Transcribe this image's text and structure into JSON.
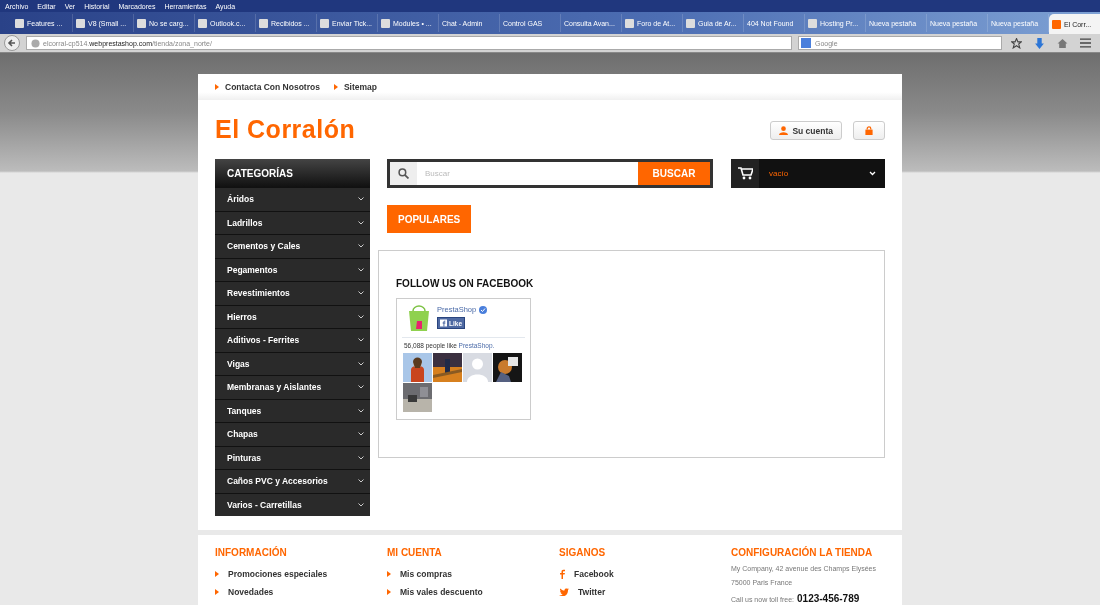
{
  "menu_bar": [
    "Archivo",
    "Editar",
    "Ver",
    "Historial",
    "Marcadores",
    "Herramientas",
    "Ayuda"
  ],
  "tabs": [
    {
      "label": "Features ...",
      "has_icon": true,
      "selected": false
    },
    {
      "label": "V8 (Small ...",
      "has_icon": true,
      "selected": false
    },
    {
      "label": "No se carg...",
      "has_icon": true,
      "selected": false
    },
    {
      "label": "Outlook.c...",
      "has_icon": true,
      "selected": false
    },
    {
      "label": "Recibidos ...",
      "has_icon": true,
      "selected": false
    },
    {
      "label": "Enviar Tick...",
      "has_icon": true,
      "selected": false
    },
    {
      "label": "Modules • ...",
      "has_icon": true,
      "selected": false
    },
    {
      "label": "Chat - Admin",
      "has_icon": false,
      "selected": false
    },
    {
      "label": "Control GAS",
      "has_icon": false,
      "selected": false
    },
    {
      "label": "Consulta Avan...",
      "has_icon": false,
      "selected": false
    },
    {
      "label": "Foro de At...",
      "has_icon": true,
      "selected": false
    },
    {
      "label": "Guia de Ar...",
      "has_icon": true,
      "selected": false
    },
    {
      "label": "404 Not Found",
      "has_icon": false,
      "selected": false
    },
    {
      "label": "Hosting Pr...",
      "has_icon": true,
      "selected": false
    },
    {
      "label": "Nueva pestaña",
      "has_icon": false,
      "selected": false
    },
    {
      "label": "Nueva pestaña",
      "has_icon": false,
      "selected": false
    },
    {
      "label": "Nueva pestaña",
      "has_icon": false,
      "selected": false
    },
    {
      "label": "El Corr...",
      "has_icon": true,
      "selected": true
    }
  ],
  "address_bar": {
    "prefix": "elcorral-cp514.",
    "domain": "webprestashop.com",
    "path": "/tienda/zona_norte/"
  },
  "search_bar": {
    "placeholder": "Google"
  },
  "top_links": [
    "Contacta Con Nosotros",
    "Sitemap"
  ],
  "logo": "El Corralón",
  "account_button": "Su cuenta",
  "categories": {
    "title": "CATEGORÍAS",
    "items": [
      "Áridos",
      "Ladrillos",
      "Cementos y Cales",
      "Pegamentos",
      "Revestimientos",
      "Hierros",
      "Aditivos - Ferrites",
      "Vigas",
      "Membranas y Aislantes",
      "Tanques",
      "Chapas",
      "Pinturas",
      "Caños PVC y Accesorios",
      "Varios - Carretillas"
    ]
  },
  "search": {
    "placeholder": "Buscar",
    "button": "BUSCAR"
  },
  "cart": {
    "status": "vacío"
  },
  "populares_button": "POPULARES",
  "facebook": {
    "title": "FOLLOW US ON FACEBOOK",
    "page_name": "PrestaShop",
    "like_button": "Like",
    "count_text": "56,088 people like ",
    "count_link": "PrestaShop.",
    "fans": [
      {
        "kind": "picture"
      },
      {
        "kind": "picture"
      },
      {
        "kind": "silhouette"
      },
      {
        "kind": "picture"
      },
      {
        "kind": "picture"
      }
    ]
  },
  "footer": [
    {
      "title": "INFORMACIÓN",
      "kind": "links",
      "items": [
        "Promociones especiales",
        "Novedades"
      ]
    },
    {
      "title": "MI CUENTA",
      "kind": "links",
      "items": [
        "Mis compras",
        "Mis vales descuento"
      ]
    },
    {
      "title": "SIGANOS",
      "kind": "social",
      "items": [
        "Facebook",
        "Twitter"
      ]
    },
    {
      "title": "CONFIGURACIÓN LA TIENDA",
      "kind": "contact",
      "items": [
        "My Company, 42 avenue des Champs Elysées",
        "75000 Paris France"
      ],
      "phone_label": "Call us now toll free:",
      "phone": "0123-456-789"
    }
  ]
}
